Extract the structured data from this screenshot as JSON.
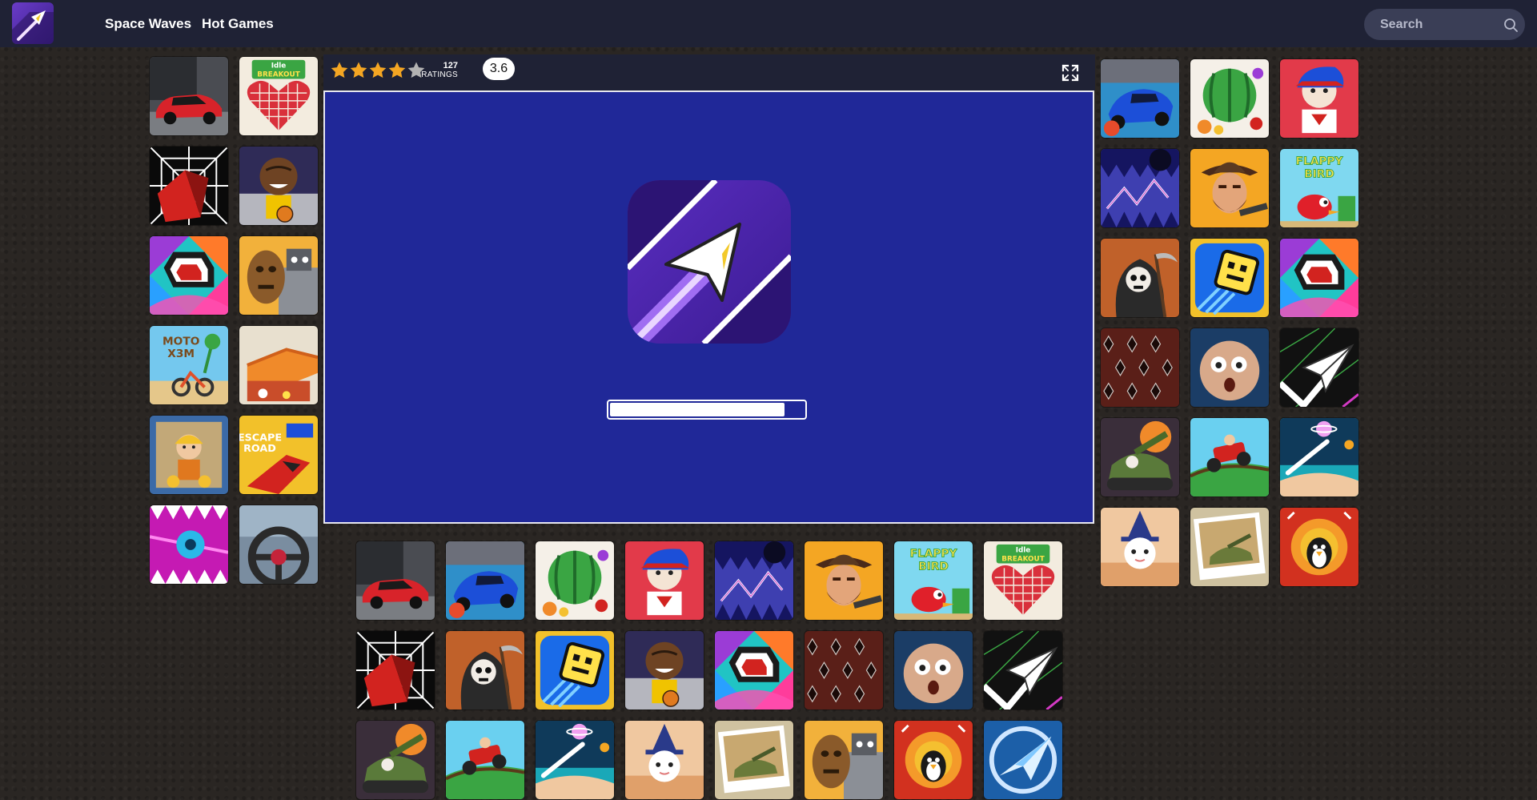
{
  "header": {
    "nav": [
      {
        "label": "Space Waves"
      },
      {
        "label": "Hot Games"
      }
    ],
    "search": {
      "placeholder": "Search"
    }
  },
  "game": {
    "rating": {
      "stars": 4,
      "max_stars": 5,
      "count": "127",
      "count_label": "RATINGS",
      "score": "3.6"
    },
    "loading_progress": 0.9
  },
  "colors": {
    "topbar": "#1f2235",
    "game_bg": "#202898",
    "star": "#f4a623",
    "background": "#2a2623"
  },
  "thumbnails": {
    "left": [
      {
        "icon": "red-car-icon"
      },
      {
        "icon": "idle-breakout-icon",
        "text": "Idle BREAKOUT"
      },
      {
        "icon": "tunnel-rush-icon"
      },
      {
        "icon": "basketball-player-icon"
      },
      {
        "icon": "slope-tunnel-icon"
      },
      {
        "icon": "robot-head-icon"
      },
      {
        "icon": "moto-x3m-icon",
        "text": "MOTO X3M"
      },
      {
        "icon": "tower-build-icon"
      },
      {
        "icon": "miner-kid-icon"
      },
      {
        "icon": "escape-road-icon",
        "text": "ESCAPE ROAD"
      },
      {
        "icon": "pink-saw-icon"
      },
      {
        "icon": "steering-wheel-icon"
      }
    ],
    "right": [
      {
        "icon": "blue-race-car-icon"
      },
      {
        "icon": "watermelon-icon"
      },
      {
        "icon": "fnf-boyfriend-icon"
      },
      {
        "icon": "wave-spikes-icon"
      },
      {
        "icon": "cowboy-icon"
      },
      {
        "icon": "flappy-bird-icon",
        "text": "FLAPPY BIRD"
      },
      {
        "icon": "grim-reaper-icon"
      },
      {
        "icon": "geometry-cube-icon"
      },
      {
        "icon": "slope-tunnel-icon"
      },
      {
        "icon": "spike-pattern-icon"
      },
      {
        "icon": "bald-head-icon"
      },
      {
        "icon": "paper-plane-icon"
      },
      {
        "icon": "tank-battle-icon"
      },
      {
        "icon": "hill-climb-icon"
      },
      {
        "icon": "planet-orbit-icon"
      },
      {
        "icon": "wizard-cat-icon"
      },
      {
        "icon": "tank-photo-icon"
      },
      {
        "icon": "penguin-flame-icon"
      }
    ],
    "bottom": [
      {
        "icon": "red-car-icon"
      },
      {
        "icon": "blue-race-car-icon"
      },
      {
        "icon": "watermelon-icon"
      },
      {
        "icon": "fnf-boyfriend-icon"
      },
      {
        "icon": "wave-spikes-icon"
      },
      {
        "icon": "cowboy-icon"
      },
      {
        "icon": "flappy-bird-icon",
        "text": "FLAPPY BIRD"
      },
      {
        "icon": "idle-breakout-icon",
        "text": "Idle BREAKOUT"
      },
      {
        "icon": "tunnel-rush-icon"
      },
      {
        "icon": "grim-reaper-icon"
      },
      {
        "icon": "geometry-cube-icon"
      },
      {
        "icon": "basketball-player-icon"
      },
      {
        "icon": "slope-tunnel-icon"
      },
      {
        "icon": "spike-pattern-icon"
      },
      {
        "icon": "bald-head-icon"
      },
      {
        "icon": "paper-plane-icon"
      },
      {
        "icon": "tank-battle-icon"
      },
      {
        "icon": "hill-climb-icon"
      },
      {
        "icon": "planet-orbit-icon"
      },
      {
        "icon": "wizard-cat-icon"
      },
      {
        "icon": "tank-photo-icon"
      },
      {
        "icon": "robot-head-icon"
      },
      {
        "icon": "penguin-flame-icon"
      },
      {
        "icon": "paper-plane-blue-icon"
      }
    ]
  }
}
